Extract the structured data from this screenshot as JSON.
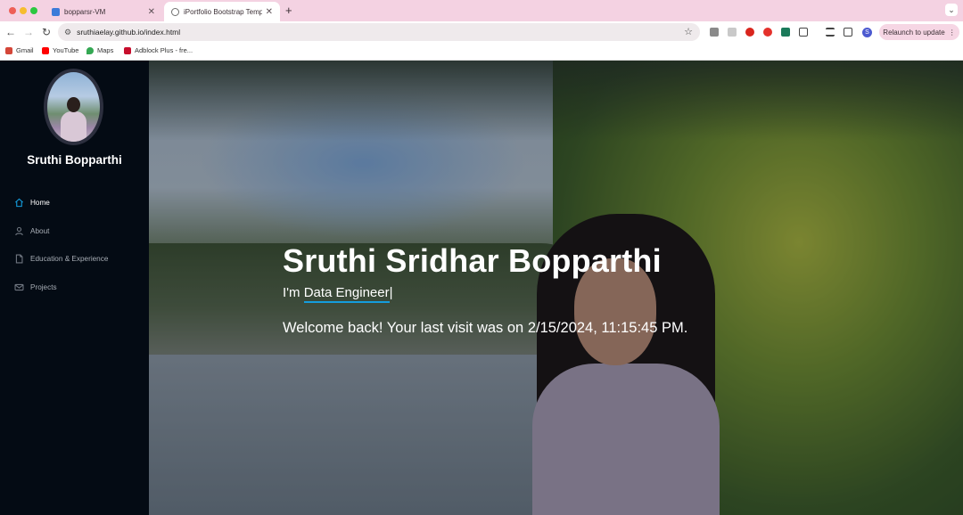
{
  "browser": {
    "tabs": [
      {
        "title": "bopparsr-VM",
        "active": false
      },
      {
        "title": "iPortfolio Bootstrap Template",
        "active": true
      }
    ],
    "url": "sruthiaelay.github.io/index.html",
    "relaunch_label": "Relaunch to update",
    "profile_initial": "S",
    "bookmarks": [
      {
        "label": "Gmail",
        "icon": "gmail-icon",
        "color": "#d44638"
      },
      {
        "label": "YouTube",
        "icon": "youtube-icon",
        "color": "#ff0000"
      },
      {
        "label": "Maps",
        "icon": "maps-icon",
        "color": "#34a853"
      },
      {
        "label": "Adblock Plus - fre...",
        "icon": "adblock-icon",
        "color": "#c70d2c"
      }
    ]
  },
  "sidebar": {
    "name": "Sruthi Bopparthi",
    "nav": [
      {
        "label": "Home",
        "icon": "home-icon",
        "active": true
      },
      {
        "label": "About",
        "icon": "user-icon",
        "active": false
      },
      {
        "label": "Education & Experience",
        "icon": "file-icon",
        "active": false
      },
      {
        "label": "Projects",
        "icon": "envelope-icon",
        "active": false
      }
    ]
  },
  "hero": {
    "title": "Sruthi Sridhar Bopparthi",
    "prefix": "I'm ",
    "typed": "Data Engineer",
    "cursor": "|",
    "welcome": "Welcome back! Your last visit was on 2/15/2024, 11:15:45 PM."
  },
  "colors": {
    "accent": "#149ddd",
    "sidebar_bg": "#040b14"
  }
}
